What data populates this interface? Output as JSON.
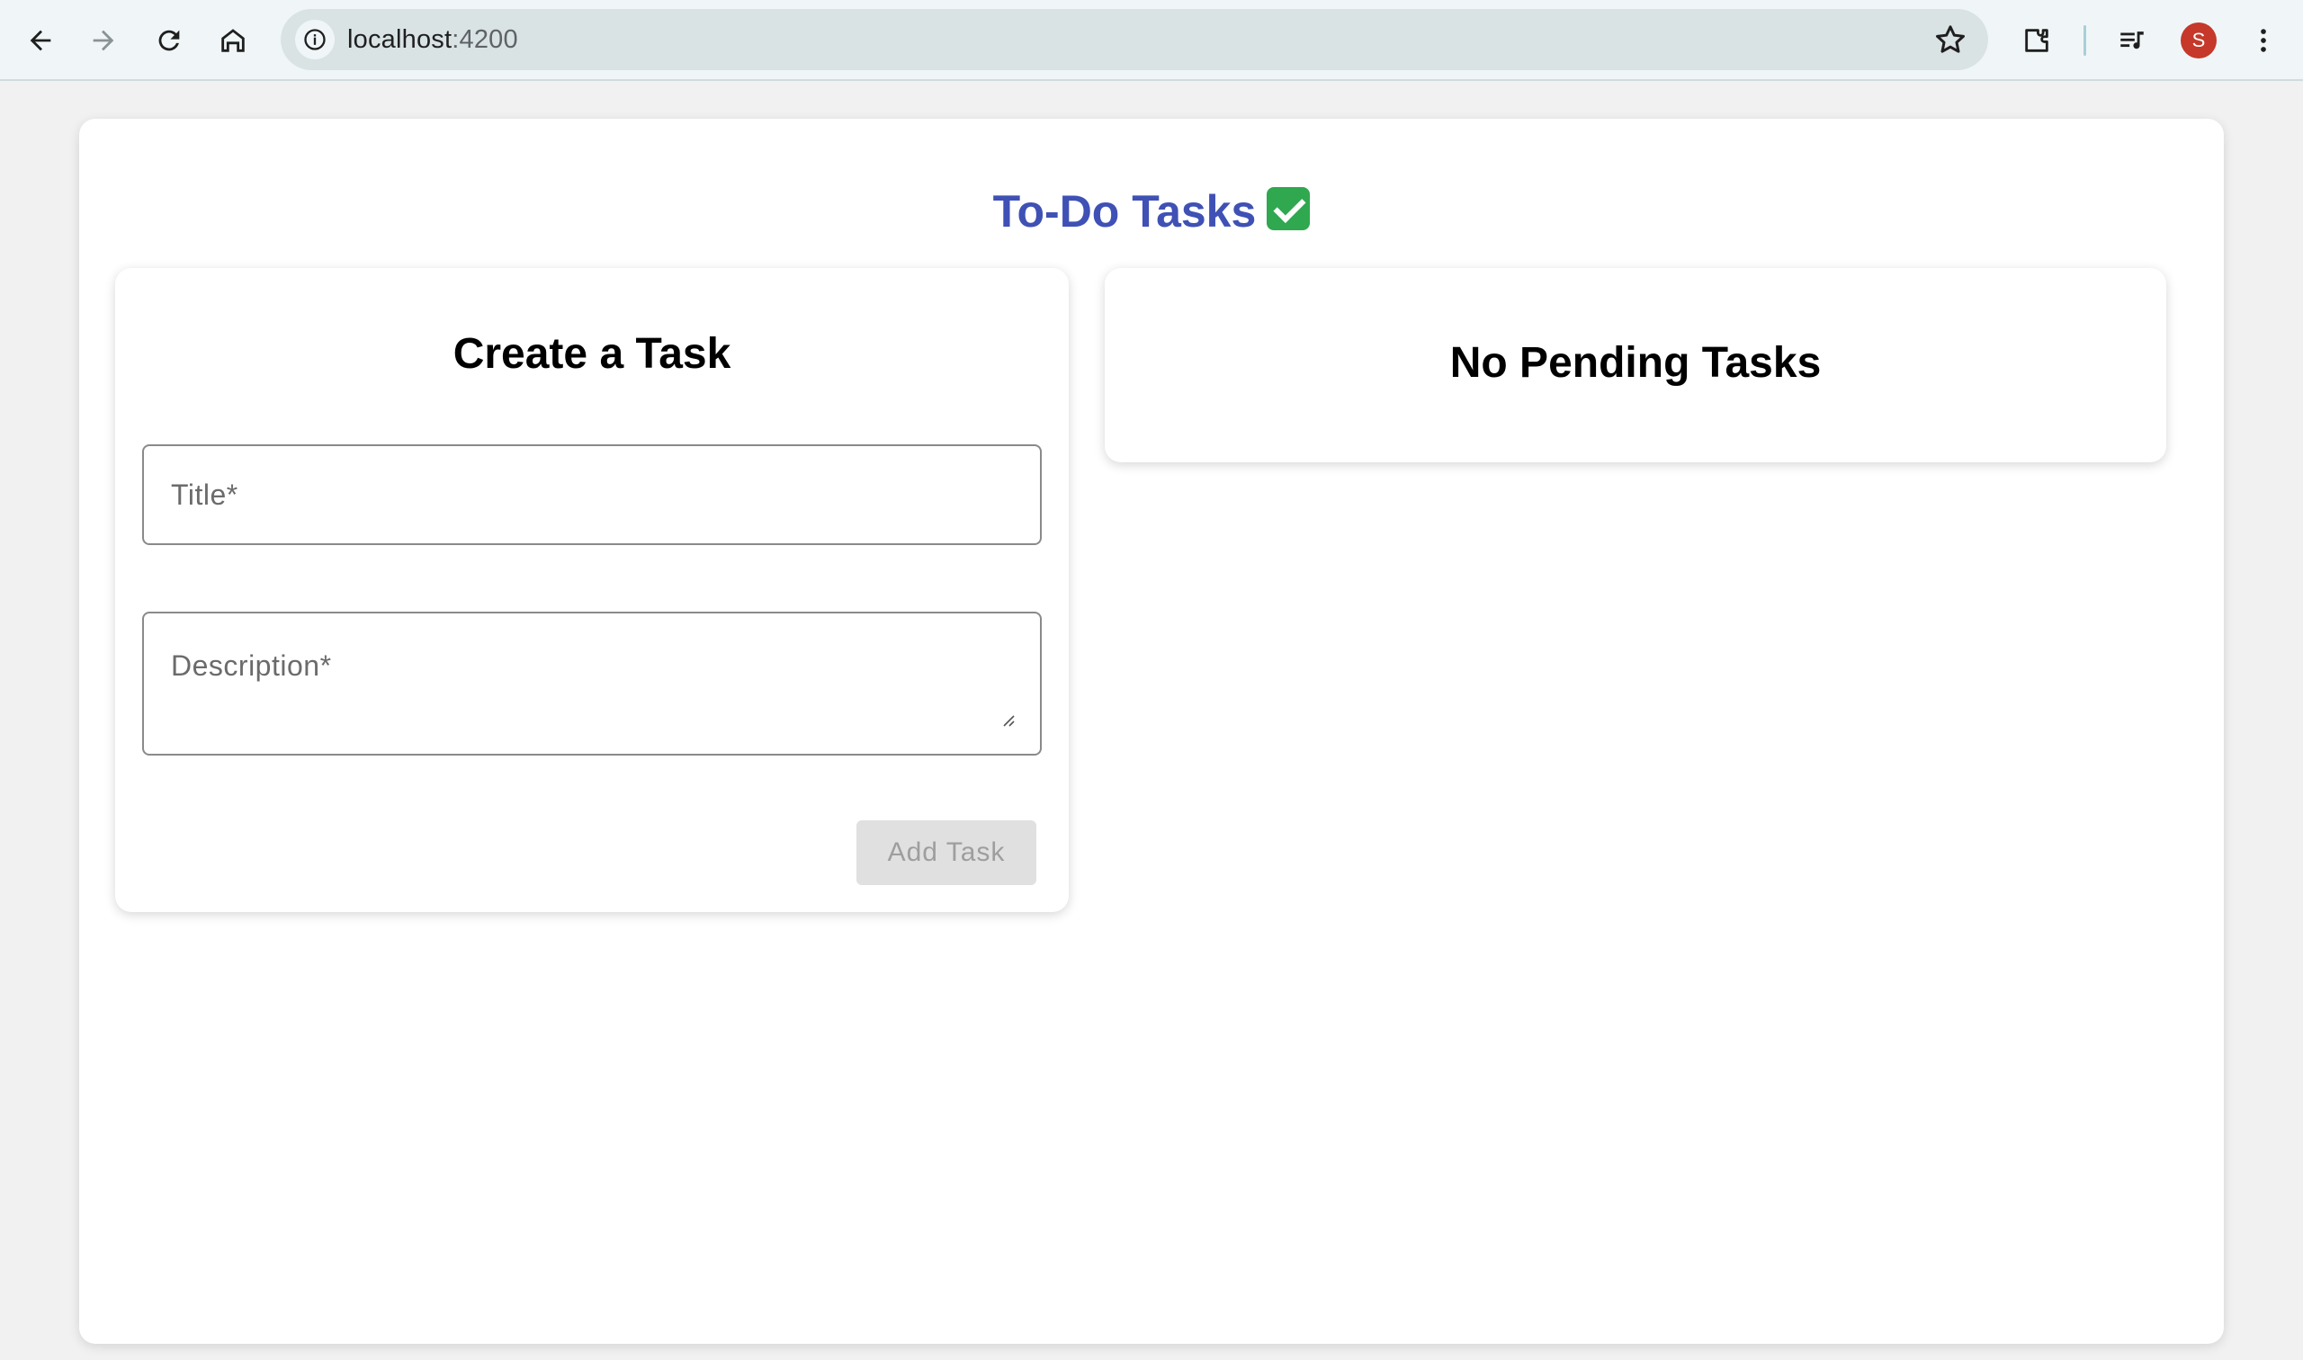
{
  "browser": {
    "url_host": "localhost",
    "url_port": ":4200",
    "profile_initial": "S"
  },
  "page": {
    "title": "To-Do Tasks"
  },
  "create_task": {
    "heading": "Create a Task",
    "title_placeholder": "Title*",
    "title_value": "",
    "description_placeholder": "Description*",
    "description_value": "",
    "add_button_label": "Add Task",
    "add_button_disabled": true
  },
  "pending": {
    "heading": "No Pending Tasks"
  },
  "colors": {
    "accent": "#3f51b5",
    "avatar": "#c5382a",
    "disabled_button_bg": "#e0e0e0",
    "disabled_button_text": "#9e9e9e"
  },
  "icons": [
    "back-arrow-icon",
    "forward-arrow-icon",
    "reload-icon",
    "home-icon",
    "info-icon",
    "star-icon",
    "extensions-icon",
    "media-controls-icon",
    "more-vert-icon",
    "check-mark-emoji-icon"
  ]
}
